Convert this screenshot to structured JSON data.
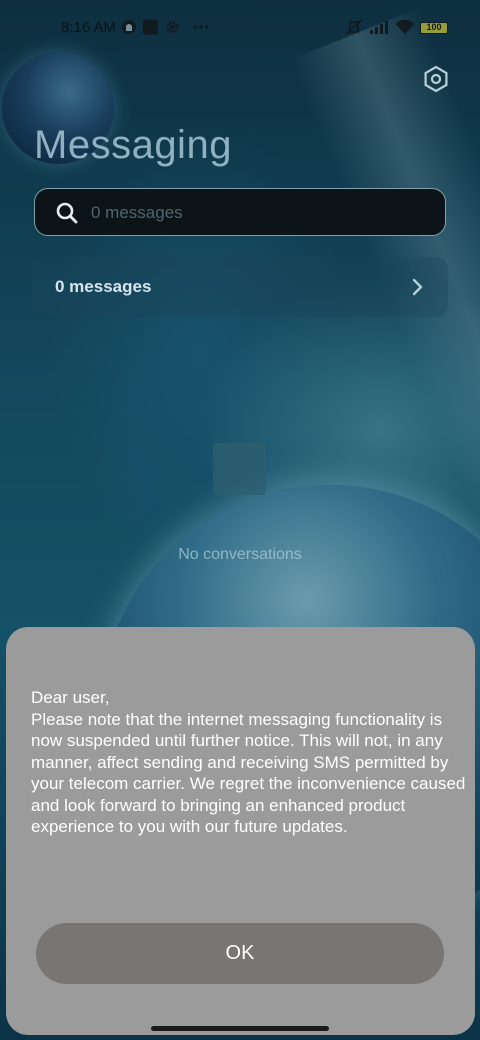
{
  "status_bar": {
    "time": "8:16 AM",
    "battery": "100",
    "icons": [
      "vpn-icon",
      "app-notification-icon",
      "settings-icon",
      "more-dots-icon",
      "mute-vibrate-icon",
      "signal-icon",
      "wifi-icon",
      "battery-icon"
    ]
  },
  "header": {
    "title": "Messaging",
    "settings_icon": "gear-hex-icon"
  },
  "search": {
    "placeholder": "0 messages",
    "value": ""
  },
  "list": {
    "row_label": "0 messages",
    "row_icon": "chevron-right-icon"
  },
  "empty_state": {
    "text": "No conversations",
    "icon": "message-bubble-icon"
  },
  "dialog": {
    "text": "Dear user,\nPlease note that the internet messaging functionality is now suspended until further notice. This will not, in any manner, affect sending and receiving SMS permitted by your telecom carrier. We regret the inconvenience caused and look forward to bringing an enhanced product experience to you with our future updates.",
    "ok_label": "OK"
  },
  "colors": {
    "dialog_bg": "#9b9b9b",
    "ok_button": "#787573",
    "title": "#8fb1c0",
    "search_bg": "#0d1418"
  }
}
